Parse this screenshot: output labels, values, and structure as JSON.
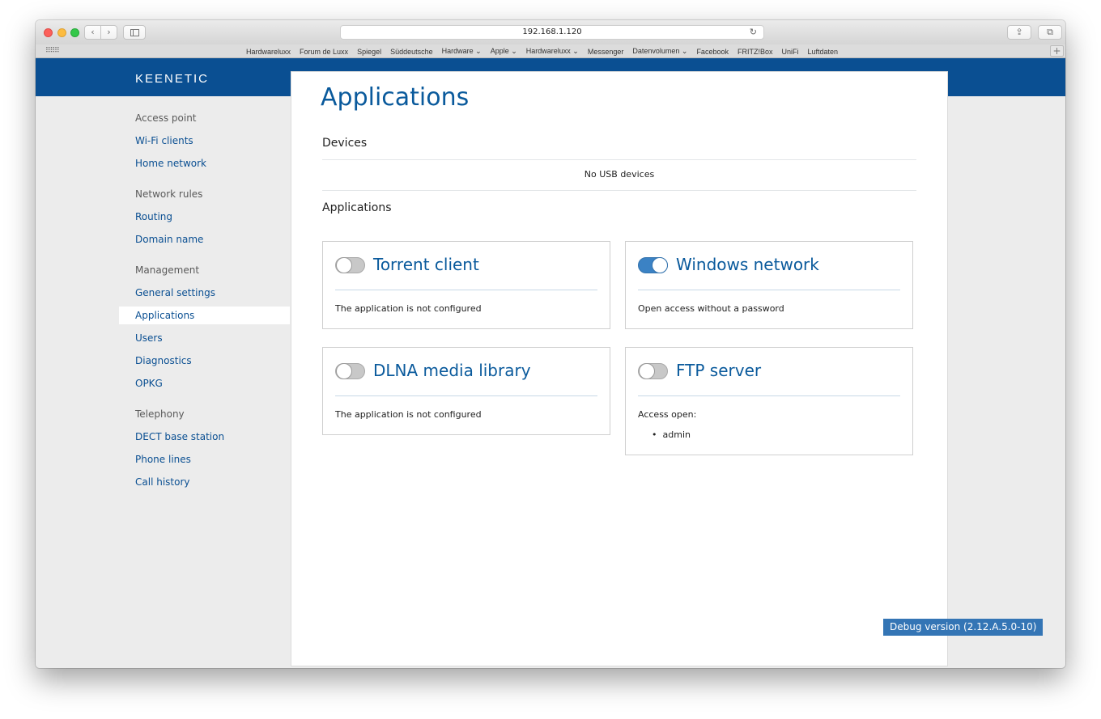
{
  "browser": {
    "url": "192.168.1.120",
    "nav_back": "‹",
    "nav_forward": "›",
    "reload": "↻",
    "share": "⇪",
    "tabs": "⧉",
    "bookmarks_grid": "⠿⠿⠿",
    "bookmarks": [
      "Hardwareluxx",
      "Forum de Luxx",
      "Spiegel",
      "Süddeutsche",
      "Hardware ⌄",
      "Apple ⌄",
      "Hardwareluxx ⌄",
      "Messenger",
      "Datenvolumen ⌄",
      "Facebook",
      "FRITZ!Box",
      "UniFi",
      "Luftdaten"
    ],
    "add_bookmark": "+"
  },
  "brand": {
    "logo": "KEENETIC"
  },
  "sidebar": {
    "groups": [
      {
        "label": "Access point",
        "items": [
          "Wi-Fi clients",
          "Home network"
        ]
      },
      {
        "label": "Network rules",
        "items": [
          "Routing",
          "Domain name"
        ]
      },
      {
        "label": "Management",
        "items": [
          "General settings",
          "Applications",
          "Users",
          "Diagnostics",
          "OPKG"
        ]
      },
      {
        "label": "Telephony",
        "items": [
          "DECT base station",
          "Phone lines",
          "Call history"
        ]
      }
    ],
    "active": "Applications"
  },
  "main": {
    "title": "Applications",
    "devices_heading": "Devices",
    "no_usb": "No USB devices",
    "applications_heading": "Applications",
    "cards": {
      "torrent": {
        "title": "Torrent client",
        "enabled": false,
        "status": "The application is not configured"
      },
      "windows": {
        "title": "Windows network",
        "enabled": true,
        "status": "Open access without a password"
      },
      "dlna": {
        "title": "DLNA media library",
        "enabled": false,
        "status": "The application is not configured"
      },
      "ftp": {
        "title": "FTP server",
        "enabled": false,
        "status": "Access open:",
        "users": [
          "admin"
        ]
      }
    }
  },
  "debug": "Debug version (2.12.A.5.0-10)"
}
